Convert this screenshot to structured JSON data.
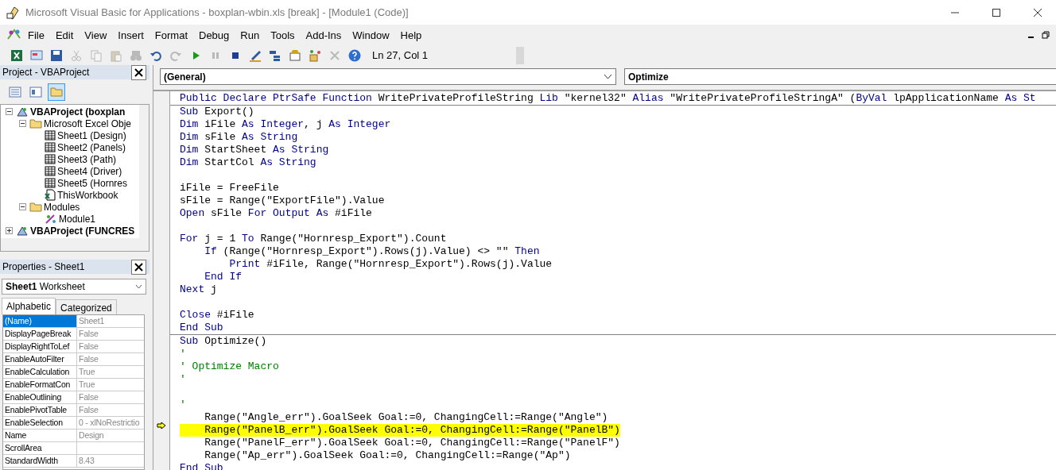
{
  "window": {
    "title": "Microsoft Visual Basic for Applications - boxplan-wbin.xls [break] - [Module1 (Code)]"
  },
  "menu": [
    "File",
    "Edit",
    "View",
    "Insert",
    "Format",
    "Debug",
    "Run",
    "Tools",
    "Add-Ins",
    "Window",
    "Help"
  ],
  "toolbar": {
    "buttons": [
      {
        "kind": "excel",
        "disabled": false
      },
      {
        "kind": "insert",
        "disabled": false
      },
      {
        "kind": "save",
        "disabled": false
      },
      {
        "kind": "cut",
        "disabled": true
      },
      {
        "kind": "copy",
        "disabled": true
      },
      {
        "kind": "paste",
        "disabled": true
      },
      {
        "kind": "find",
        "disabled": true
      },
      {
        "kind": "undo",
        "disabled": false
      },
      {
        "kind": "redo",
        "disabled": true
      },
      {
        "kind": "run",
        "disabled": false
      },
      {
        "kind": "break",
        "disabled": true
      },
      {
        "kind": "reset",
        "disabled": false
      },
      {
        "kind": "design",
        "disabled": false
      },
      {
        "kind": "explorer",
        "disabled": false
      },
      {
        "kind": "properties",
        "disabled": false
      },
      {
        "kind": "browser",
        "disabled": false
      },
      {
        "kind": "toolbox",
        "disabled": true
      },
      {
        "kind": "help",
        "disabled": false
      }
    ],
    "position": "Ln 27, Col 1"
  },
  "project": {
    "title": "Project - VBAProject",
    "tree": [
      {
        "label": "VBAProject (boxplan",
        "kind": "project",
        "expanded": true,
        "children": [
          {
            "label": "Microsoft Excel Obje",
            "kind": "folder",
            "expanded": true,
            "children": [
              {
                "label": "Sheet1 (Design)",
                "kind": "sheet"
              },
              {
                "label": "Sheet2 (Panels)",
                "kind": "sheet"
              },
              {
                "label": "Sheet3 (Path)",
                "kind": "sheet"
              },
              {
                "label": "Sheet4 (Driver)",
                "kind": "sheet"
              },
              {
                "label": "Sheet5 (Hornres",
                "kind": "sheet"
              },
              {
                "label": "ThisWorkbook",
                "kind": "workbook"
              }
            ]
          },
          {
            "label": "Modules",
            "kind": "folder",
            "expanded": true,
            "children": [
              {
                "label": "Module1",
                "kind": "module"
              }
            ]
          }
        ]
      },
      {
        "label": "VBAProject (FUNCRES",
        "kind": "project",
        "expanded": false
      }
    ]
  },
  "properties": {
    "title": "Properties - Sheet1",
    "object": {
      "name": "Sheet1",
      "type": "Worksheet"
    },
    "tabs": [
      {
        "label": "Alphabetic",
        "selected": true
      },
      {
        "label": "Categorized",
        "selected": false
      }
    ],
    "rows": [
      {
        "name": "(Name)",
        "value": "Sheet1",
        "selected": true
      },
      {
        "name": "DisplayPageBreak",
        "value": "False",
        "selected": false
      },
      {
        "name": "DisplayRightToLef",
        "value": "False",
        "selected": false
      },
      {
        "name": "EnableAutoFilter",
        "value": "False",
        "selected": false
      },
      {
        "name": "EnableCalculation",
        "value": "True",
        "selected": false
      },
      {
        "name": "EnableFormatCon",
        "value": "True",
        "selected": false
      },
      {
        "name": "EnableOutlining",
        "value": "False",
        "selected": false
      },
      {
        "name": "EnablePivotTable",
        "value": "False",
        "selected": false
      },
      {
        "name": "EnableSelection",
        "value": "0 - xlNoRestrictio",
        "selected": false
      },
      {
        "name": "Name",
        "value": "Design",
        "selected": false
      },
      {
        "name": "ScrollArea",
        "selected": false
      },
      {
        "name": "StandardWidth",
        "value": "8.43",
        "selected": false
      }
    ]
  },
  "code": {
    "object": "(General)",
    "procedure": "Optimize",
    "sections": [
      {
        "lines": [
          {
            "kind": "code",
            "current": false,
            "tokens": [
              {
                "kind": "kw",
                "text": "Public Declare PtrSafe Function"
              },
              {
                "kind": "text",
                "text": " WritePrivateProfileString "
              },
              {
                "kind": "kw",
                "text": "Lib"
              },
              {
                "kind": "text",
                "text": " \"kernel32\" "
              },
              {
                "kind": "kw",
                "text": "Alias"
              },
              {
                "kind": "text",
                "text": " \"WritePrivateProfileStringA\" ("
              },
              {
                "kind": "kw",
                "text": "ByVal"
              },
              {
                "kind": "text",
                "text": " lpApplicationName "
              },
              {
                "kind": "kw",
                "text": "As St"
              }
            ]
          }
        ]
      },
      {
        "lines": [
          {
            "kind": "code",
            "current": false,
            "tokens": [
              {
                "kind": "kw",
                "text": "Sub"
              },
              {
                "kind": "text",
                "text": " Export()"
              }
            ]
          },
          {
            "kind": "code",
            "current": false,
            "tokens": [
              {
                "kind": "kw",
                "text": "Dim"
              },
              {
                "kind": "text",
                "text": " iFile "
              },
              {
                "kind": "kw",
                "text": "As Integer"
              },
              {
                "kind": "text",
                "text": ", j "
              },
              {
                "kind": "kw",
                "text": "As Integer"
              }
            ]
          },
          {
            "kind": "code",
            "current": false,
            "tokens": [
              {
                "kind": "kw",
                "text": "Dim"
              },
              {
                "kind": "text",
                "text": " sFile "
              },
              {
                "kind": "kw",
                "text": "As String"
              }
            ]
          },
          {
            "kind": "code",
            "current": false,
            "tokens": [
              {
                "kind": "kw",
                "text": "Dim"
              },
              {
                "kind": "text",
                "text": " StartSheet "
              },
              {
                "kind": "kw",
                "text": "As String"
              }
            ]
          },
          {
            "kind": "code",
            "current": false,
            "tokens": [
              {
                "kind": "kw",
                "text": "Dim"
              },
              {
                "kind": "text",
                "text": " StartCol "
              },
              {
                "kind": "kw",
                "text": "As String"
              }
            ]
          },
          {
            "kind": "blank"
          },
          {
            "kind": "code",
            "current": false,
            "tokens": [
              {
                "kind": "text",
                "text": "iFile = FreeFile"
              }
            ]
          },
          {
            "kind": "code",
            "current": false,
            "tokens": [
              {
                "kind": "text",
                "text": "sFile = Range(\"ExportFile\").Value"
              }
            ]
          },
          {
            "kind": "code",
            "current": false,
            "tokens": [
              {
                "kind": "kw",
                "text": "Open"
              },
              {
                "kind": "text",
                "text": " sFile "
              },
              {
                "kind": "kw",
                "text": "For Output As"
              },
              {
                "kind": "text",
                "text": " #iFile"
              }
            ]
          },
          {
            "kind": "blank"
          },
          {
            "kind": "code",
            "current": false,
            "tokens": [
              {
                "kind": "kw",
                "text": "For"
              },
              {
                "kind": "text",
                "text": " j = 1 "
              },
              {
                "kind": "kw",
                "text": "To"
              },
              {
                "kind": "text",
                "text": " Range(\"Hornresp_Export\").Count"
              }
            ]
          },
          {
            "kind": "code",
            "current": false,
            "tokens": [
              {
                "kind": "kw",
                "text": "    If"
              },
              {
                "kind": "text",
                "text": " (Range(\"Hornresp_Export\").Rows(j).Value) <> \"\" "
              },
              {
                "kind": "kw",
                "text": "Then"
              }
            ]
          },
          {
            "kind": "code",
            "current": false,
            "tokens": [
              {
                "kind": "kw",
                "text": "        Print"
              },
              {
                "kind": "text",
                "text": " #iFile, Range(\"Hornresp_Export\").Rows(j).Value"
              }
            ]
          },
          {
            "kind": "code",
            "current": false,
            "tokens": [
              {
                "kind": "kw",
                "text": "    End If"
              }
            ]
          },
          {
            "kind": "code",
            "current": false,
            "tokens": [
              {
                "kind": "kw",
                "text": "Next"
              },
              {
                "kind": "text",
                "text": " j"
              }
            ]
          },
          {
            "kind": "blank"
          },
          {
            "kind": "code",
            "current": false,
            "tokens": [
              {
                "kind": "kw",
                "text": "Close"
              },
              {
                "kind": "text",
                "text": " #iFile"
              }
            ]
          },
          {
            "kind": "code",
            "current": false,
            "tokens": [
              {
                "kind": "kw",
                "text": "End Sub"
              }
            ]
          }
        ]
      },
      {
        "lines": [
          {
            "kind": "code",
            "current": false,
            "tokens": [
              {
                "kind": "kw",
                "text": "Sub"
              },
              {
                "kind": "text",
                "text": " Optimize()"
              }
            ]
          },
          {
            "kind": "code",
            "current": false,
            "tokens": [
              {
                "kind": "comment",
                "text": "'"
              }
            ]
          },
          {
            "kind": "code",
            "current": false,
            "tokens": [
              {
                "kind": "comment",
                "text": "' Optimize Macro"
              }
            ]
          },
          {
            "kind": "code",
            "current": false,
            "tokens": [
              {
                "kind": "comment",
                "text": "'"
              }
            ]
          },
          {
            "kind": "blank"
          },
          {
            "kind": "code",
            "current": false,
            "tokens": [
              {
                "kind": "comment",
                "text": "'"
              }
            ]
          },
          {
            "kind": "code",
            "current": false,
            "tokens": [
              {
                "kind": "text",
                "text": "    Range(\"Angle_err\").GoalSeek Goal:=0, ChangingCell:=Range(\"Angle\")"
              }
            ]
          },
          {
            "kind": "code",
            "current": true,
            "tokens": [
              {
                "kind": "text",
                "text": "    Range(\"PanelB_err\").GoalSeek Goal:=0, ChangingCell:=Range(\"PanelB\")"
              }
            ]
          },
          {
            "kind": "code",
            "current": false,
            "tokens": [
              {
                "kind": "text",
                "text": "    Range(\"PanelF_err\").GoalSeek Goal:=0, ChangingCell:=Range(\"PanelF\")"
              }
            ]
          },
          {
            "kind": "code",
            "current": false,
            "tokens": [
              {
                "kind": "text",
                "text": "    Range(\"Ap_err\").GoalSeek Goal:=0, ChangingCell:=Range(\"Ap\")"
              }
            ]
          },
          {
            "kind": "code",
            "current": false,
            "tokens": [
              {
                "kind": "kw",
                "text": "End Sub"
              }
            ]
          }
        ]
      }
    ]
  }
}
